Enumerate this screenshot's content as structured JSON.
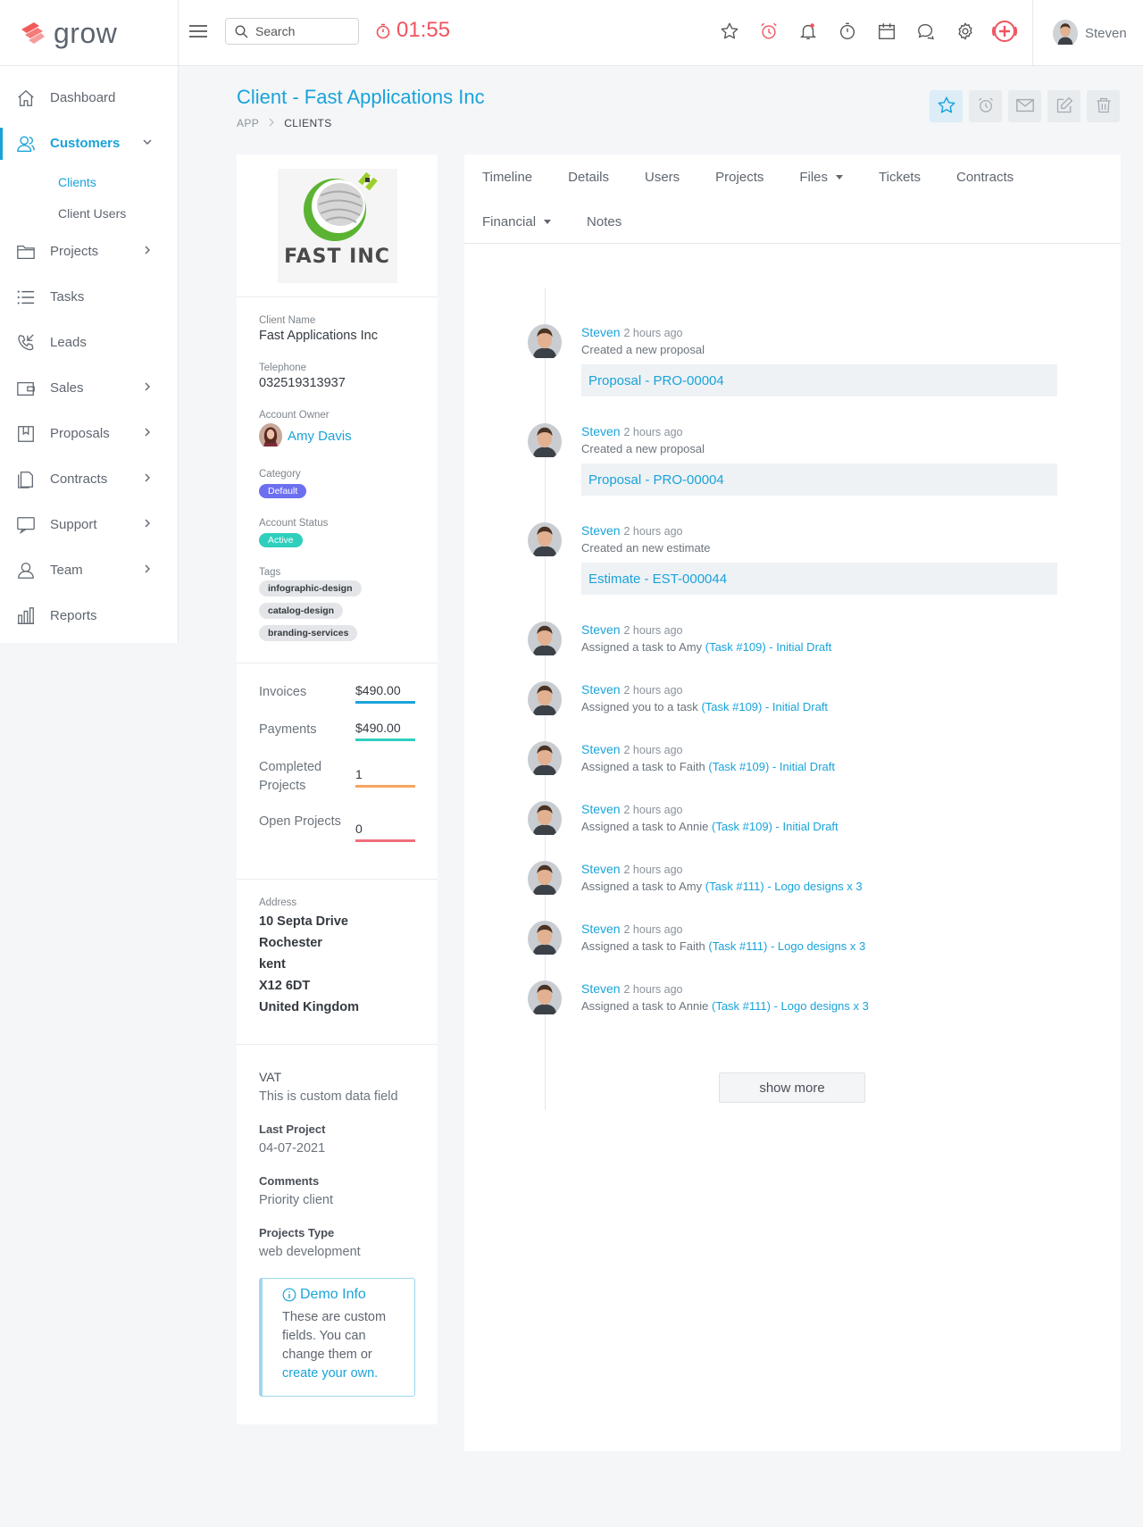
{
  "brand": {
    "name": "grow"
  },
  "topbar": {
    "search_placeholder": "Search",
    "timer": "01:55",
    "icons": [
      "star-icon",
      "alarm-icon",
      "bell-icon",
      "stopwatch-icon",
      "calendar-icon",
      "chat-icon",
      "gear-icon",
      "add-circle-icon"
    ],
    "user_name": "Steven"
  },
  "sidebar": {
    "items": [
      {
        "label": "Dashboard",
        "icon": "home-icon",
        "chevron": false
      },
      {
        "label": "Customers",
        "icon": "users-icon",
        "chevron": "down",
        "active": true
      },
      {
        "label": "Projects",
        "icon": "folder-icon",
        "chevron": "right"
      },
      {
        "label": "Tasks",
        "icon": "list-icon",
        "chevron": false
      },
      {
        "label": "Leads",
        "icon": "phone-icon",
        "chevron": false
      },
      {
        "label": "Sales",
        "icon": "wallet-icon",
        "chevron": "right"
      },
      {
        "label": "Proposals",
        "icon": "bookmark-icon",
        "chevron": "right"
      },
      {
        "label": "Contracts",
        "icon": "document-icon",
        "chevron": "right"
      },
      {
        "label": "Support",
        "icon": "support-icon",
        "chevron": "right"
      },
      {
        "label": "Team",
        "icon": "user-icon",
        "chevron": "right"
      },
      {
        "label": "Reports",
        "icon": "bar-chart-icon",
        "chevron": false
      }
    ],
    "sub_items": [
      {
        "label": "Clients",
        "active": true
      },
      {
        "label": "Client Users"
      }
    ]
  },
  "page": {
    "title": "Client - Fast Applications Inc",
    "breadcrumb": [
      "APP",
      "CLIENTS"
    ],
    "actions": [
      "star-icon",
      "alarm-icon",
      "mail-icon",
      "edit-icon",
      "trash-icon"
    ]
  },
  "client": {
    "logo_text": "FAST INC",
    "fields": {
      "client_name_label": "Client Name",
      "client_name": "Fast Applications Inc",
      "telephone_label": "Telephone",
      "telephone": "032519313937",
      "owner_label": "Account Owner",
      "owner_name": "Amy Davis",
      "category_label": "Category",
      "category": "Default",
      "status_label": "Account Status",
      "status": "Active",
      "tags_label": "Tags"
    },
    "tags": [
      "infographic-design",
      "catalog-design",
      "branding-services"
    ],
    "stats": [
      {
        "label": "Invoices",
        "value": "$490.00",
        "color": "#1aa3d9"
      },
      {
        "label": "Payments",
        "value": "$490.00",
        "color": "#2ecfbd"
      },
      {
        "label": "Completed Projects",
        "value": "1",
        "color": "#f7a55e"
      },
      {
        "label": "Open Projects",
        "value": "0",
        "color": "#f06e7c"
      }
    ],
    "address_label": "Address",
    "address": [
      "10 Septa Drive",
      "Rochester",
      "kent",
      "X12 6DT",
      "United Kingdom"
    ],
    "custom_fields": [
      {
        "label": "VAT",
        "value": "This is custom data field",
        "label_style": "plain"
      },
      {
        "label": "Last Project",
        "value": "04-07-2021"
      },
      {
        "label": "Comments",
        "value": "Priority client"
      },
      {
        "label": "Projects Type",
        "value": "web development"
      }
    ],
    "demo": {
      "title": "Demo Info",
      "text": "These are custom fields. You can change them or",
      "link": "create your own."
    }
  },
  "tabs": {
    "row1": [
      {
        "label": "Timeline"
      },
      {
        "label": "Details"
      },
      {
        "label": "Users"
      },
      {
        "label": "Projects"
      },
      {
        "label": "Files",
        "dropdown": true
      },
      {
        "label": "Tickets"
      },
      {
        "label": "Contracts"
      }
    ],
    "row2": [
      {
        "label": "Financial",
        "dropdown": true
      },
      {
        "label": "Notes"
      }
    ]
  },
  "timeline": {
    "events": [
      {
        "user": "Steven",
        "time": "2 hours ago",
        "text": "Created a new proposal",
        "box": "Proposal - PRO-00004"
      },
      {
        "user": "Steven",
        "time": "2 hours ago",
        "text": "Created a new proposal",
        "box": "Proposal - PRO-00004"
      },
      {
        "user": "Steven",
        "time": "2 hours ago",
        "text": "Created an new estimate",
        "box": "Estimate - EST-000044"
      },
      {
        "user": "Steven",
        "time": "2 hours ago",
        "text": "Assigned a task to Amy",
        "link": "(Task #109) - Initial Draft"
      },
      {
        "user": "Steven",
        "time": "2 hours ago",
        "text": "Assigned you to a task",
        "link": "(Task #109) - Initial Draft"
      },
      {
        "user": "Steven",
        "time": "2 hours ago",
        "text": "Assigned a task to Faith",
        "link": "(Task #109) - Initial Draft"
      },
      {
        "user": "Steven",
        "time": "2 hours ago",
        "text": "Assigned a task to Annie",
        "link": "(Task #109) - Initial Draft"
      },
      {
        "user": "Steven",
        "time": "2 hours ago",
        "text": "Assigned a task to Amy",
        "link": "(Task #111) - Logo designs x 3"
      },
      {
        "user": "Steven",
        "time": "2 hours ago",
        "text": "Assigned a task to Faith",
        "link": "(Task #111) - Logo designs x 3"
      },
      {
        "user": "Steven",
        "time": "2 hours ago",
        "text": "Assigned a task to Annie",
        "link": "(Task #111) - Logo designs x 3"
      }
    ],
    "show_more": "show more"
  },
  "colors": {
    "accent": "#1aa3d9",
    "timer": "#f0535f",
    "badge_default": "#6c6ff0",
    "badge_active": "#2ecfbd"
  }
}
